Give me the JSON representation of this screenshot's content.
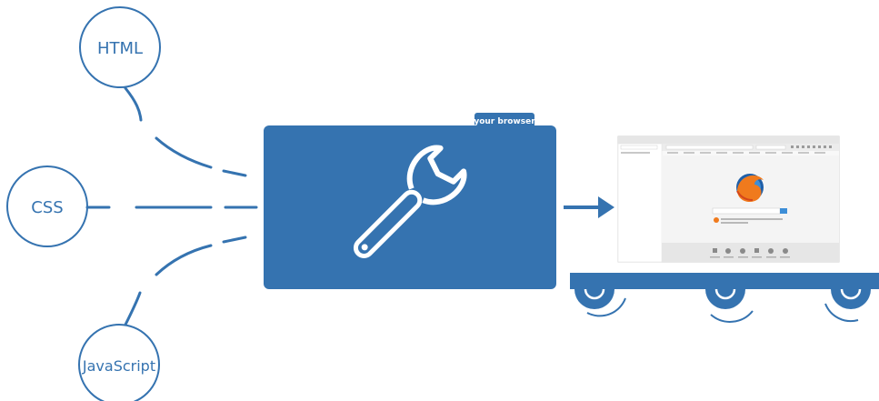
{
  "colors": {
    "primary": "#3573b0",
    "accent": "#4a85bd",
    "light_gray": "#e6e6e6",
    "mid_gray": "#d0d0d0",
    "dark_gray": "#9b9b9b"
  },
  "inputs": {
    "html": "HTML",
    "css": "CSS",
    "javascript": "JavaScript"
  },
  "browser_box": {
    "tab_label": "your browser",
    "icon": "wrench-icon"
  },
  "preview": {
    "icon": "firefox-logo-icon",
    "caption": "rendered browser window on a conveyor belt"
  }
}
